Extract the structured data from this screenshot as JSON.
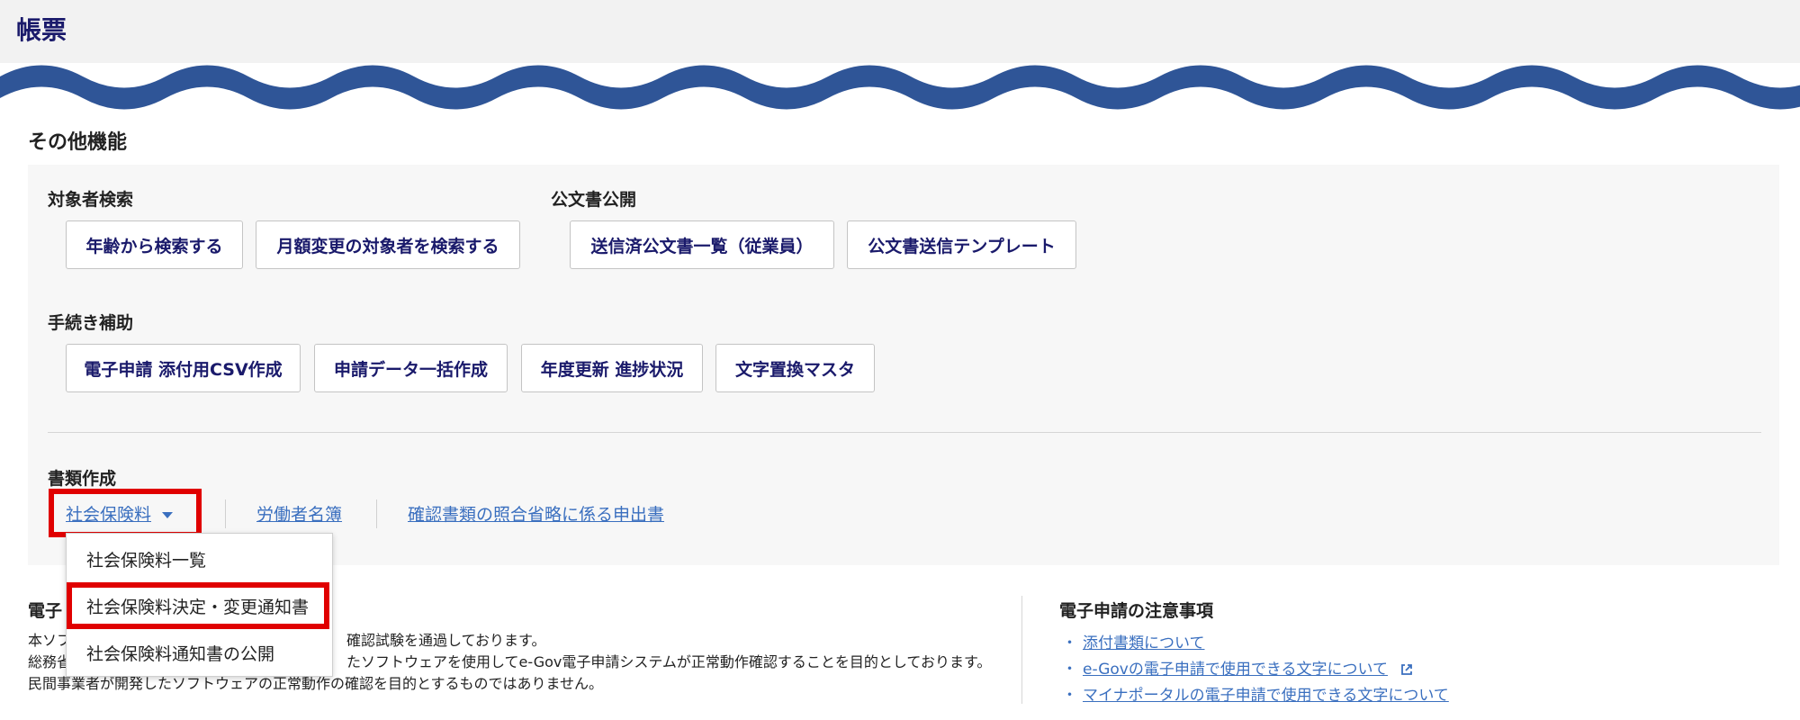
{
  "header": {
    "title": "帳票"
  },
  "colors": {
    "accent": "#2f5597",
    "title": "#1a1a6b",
    "link": "#3a6fbf",
    "highlight": "#e00000"
  },
  "other_functions": {
    "title": "その他機能",
    "target_search": {
      "label": "対象者検索",
      "buttons": [
        "年齢から検索する",
        "月額変更の対象者を検索する"
      ]
    },
    "public_docs": {
      "label": "公文書公開",
      "buttons": [
        "送信済公文書一覧（従業員）",
        "公文書送信テンプレート"
      ]
    },
    "procedure_support": {
      "label": "手続き補助",
      "buttons": [
        "電子申請 添付用CSV作成",
        "申請データ一括作成",
        "年度更新 進捗状況",
        "文字置換マスタ"
      ]
    },
    "document_creation": {
      "label": "書類作成",
      "links": [
        "社会保険料",
        "労働者名簿",
        "確認書類の照合省略に係る申出書"
      ],
      "dropdown_items": [
        "社会保険料一覧",
        "社会保険料決定・変更通知書",
        "社会保険料通知書の公開"
      ]
    }
  },
  "notice": {
    "title_visible": "電子",
    "body_visible": [
      "本ソフ",
      "総務省",
      "民間事業者が開発したソフトウェアの正常動作の確認を目的とするものではありません。"
    ],
    "body_visible_right": [
      "確認試験を通過しております。",
      "たソフトウェアを使用してe-Gov電子申請システムが正常動作確認することを目的としております。",
      ""
    ]
  },
  "cautions": {
    "title": "電子申請の注意事項",
    "links": [
      "添付書類について",
      "e-Govの電子申請で使用できる文字について",
      "マイナポータルの電子申請で使用できる文字について"
    ],
    "bullet": "・",
    "external_icon": "external-link-icon"
  }
}
